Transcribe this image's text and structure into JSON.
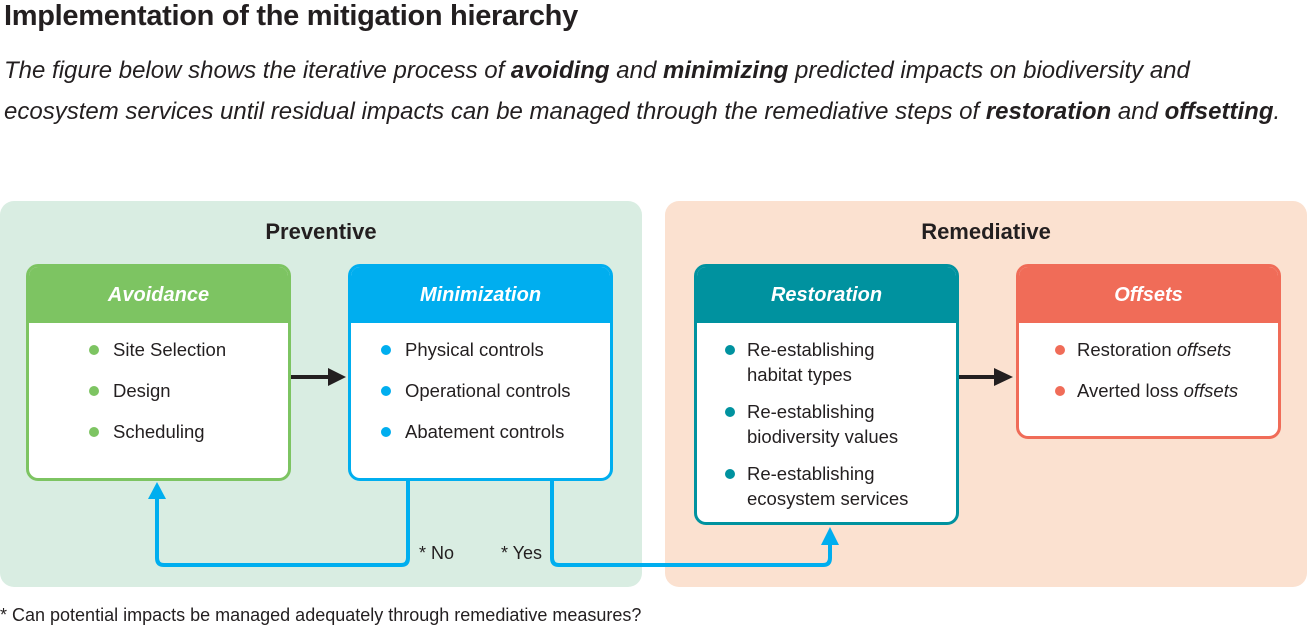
{
  "header": {
    "title": "Implementation of the mitigation hierarchy",
    "intro": {
      "p1": "The figure below shows the iterative process of ",
      "b1": "avoiding",
      "p2": " and ",
      "b2": "minimizing",
      "p3": " predicted impacts on biodiversity and ecosystem services until residual impacts can be managed through the remediative steps of ",
      "b3": "restoration",
      "p4": " and ",
      "b4": "offsetting",
      "p5": "."
    }
  },
  "colors": {
    "preventive_bg": "#d9ede2",
    "remediative_bg": "#fbe1d0",
    "avoidance": "#7dc462",
    "minimization": "#00aeef",
    "restoration": "#00929f",
    "offsets": "#f06c58",
    "arrow_dark": "#231f20",
    "loop_arrow": "#00aeef"
  },
  "panels": {
    "preventive": {
      "title": "Preventive"
    },
    "remediative": {
      "title": "Remediative"
    }
  },
  "boxes": {
    "avoidance": {
      "title": "Avoidance",
      "items": [
        "Site Selection",
        "Design",
        "Scheduling"
      ]
    },
    "minimization": {
      "title": "Minimization",
      "items": [
        "Physical controls",
        "Operational controls",
        "Abatement controls"
      ]
    },
    "restoration": {
      "title": "Restoration",
      "items": [
        {
          "line1": "Re-establishing",
          "line2": "habitat types"
        },
        {
          "line1": "Re-establishing",
          "line2": "biodiversity values"
        },
        {
          "line1": "Re-establishing",
          "line2": "ecosystem services"
        }
      ]
    },
    "offsets": {
      "title": "Offsets",
      "items": [
        {
          "text": "Restoration ",
          "ital": "offsets"
        },
        {
          "text": "Averted loss ",
          "ital": "offsets"
        }
      ]
    }
  },
  "decision_labels": {
    "no": "* No",
    "yes": "* Yes"
  },
  "footnote": "* Can potential impacts be managed adequately through remediative measures?"
}
